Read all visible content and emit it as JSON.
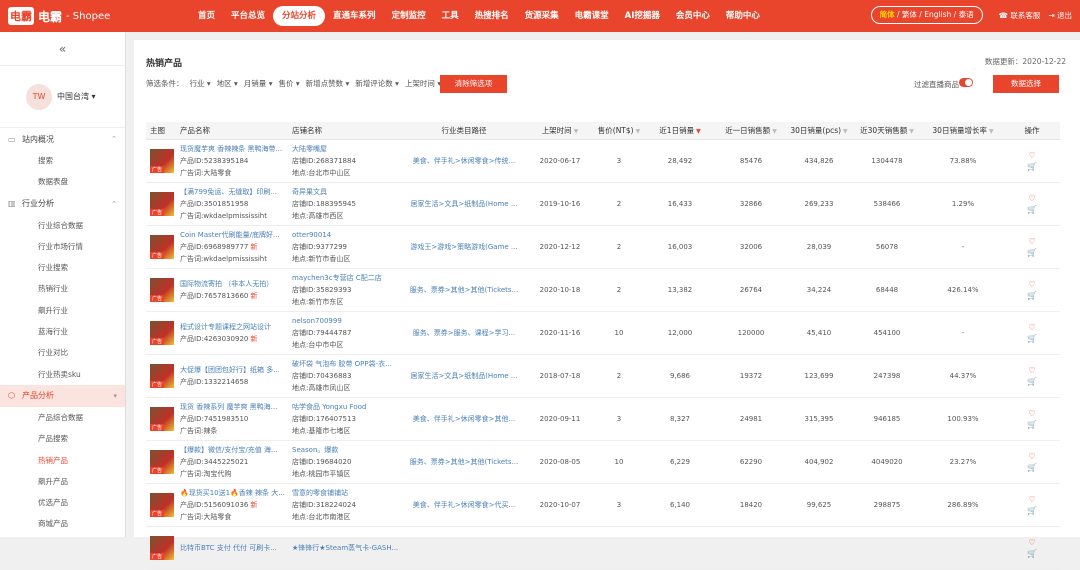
{
  "brand": {
    "mark": "电霸",
    "name": "电霸",
    "sub": "- Shopee"
  },
  "nav": [
    "首页",
    "平台总览",
    "分站分析",
    "直通车系列",
    "定制监控",
    "工具",
    "热搜排名",
    "货源采集",
    "电霸课堂",
    "AI挖掘器",
    "会员中心",
    "帮助中心"
  ],
  "nav_active": "分站分析",
  "lang": {
    "current": "简体",
    "others": " / 繁体 / English / 泰语"
  },
  "top_links": {
    "service": "联系客服",
    "logout": "退出"
  },
  "sidebar": {
    "collapse": "«",
    "avatar": "TW",
    "region": "中国台湾 ▾",
    "sections": [
      {
        "label": "站内概况",
        "items": [
          "搜索",
          "数据表盘"
        ]
      },
      {
        "label": "行业分析",
        "items": [
          "行业综合数据",
          "行业市场行情",
          "行业搜索",
          "热销行业",
          "飙升行业",
          "蓝海行业",
          "行业对比",
          "行业热卖sku"
        ]
      },
      {
        "label": "产品分析",
        "items": [
          "产品综合数据",
          "产品搜索",
          "热销产品",
          "飙升产品",
          "优选产品",
          "商城产品",
          "上新产品"
        ]
      }
    ],
    "current": "热销产品"
  },
  "page": {
    "title": "热销产品",
    "update": "数据更新：2020-12-22",
    "filter_label": "筛选条件：",
    "filters": [
      "行业 ▾",
      "地区 ▾",
      "月销量 ▾",
      "售价 ▾",
      "新增点赞数 ▾",
      "新增评论数 ▾",
      "上架时间 ▾"
    ],
    "clear_btn": "清除筛选项",
    "toggle_label": "过滤直播商品",
    "data_btn": "数据选择"
  },
  "columns": [
    "主图",
    "产品名称",
    "店铺名称",
    "行业类目路径",
    "上架时间",
    "售价(NT$)",
    "近1日销量",
    "近一日销售额",
    "30日销量(pcs)",
    "近30天销售额",
    "30日销量增长率",
    "操作"
  ],
  "rows": [
    {
      "name": "现货魔芋爽 香辣辣条 黑鸭海带...",
      "pid": "产品ID:5238395184",
      "kw": "广告词:大陆零食",
      "new": "",
      "shop": "大陆零嘴屋",
      "sid": "店铺ID:268371884",
      "addr": "地点:台北市中山区",
      "cat": "美食、伴手礼>休闲零食>传统...",
      "date": "2020-06-17",
      "price": "3",
      "d1": "28,492",
      "d1s": "85476",
      "m30": "434,826",
      "m30s": "1304478",
      "g": "73.88%"
    },
    {
      "name": "【满799免运、无缝取】印刷...",
      "pid": "产品ID:3501851958",
      "kw": "广告词:wkdaelpmississiht",
      "new": "",
      "shop": "奇异果文具",
      "sid": "店铺ID:188395945",
      "addr": "地点:高雄市西区",
      "cat": "居家生活>文具>纸制品(Home ...",
      "date": "2019-10-16",
      "price": "2",
      "d1": "16,433",
      "d1s": "32866",
      "m30": "269,233",
      "m30s": "538466",
      "g": "1.29%"
    },
    {
      "name": "Coin Master代刷能量/底牌好...",
      "pid": "产品ID:6968989777",
      "kw": "广告词:wkdaelpmississiht",
      "new": "新",
      "shop": "otter90014",
      "sid": "店铺ID:9377299",
      "addr": "地点:新竹市香山区",
      "cat": "游戏王>游戏>策略游戏(Game ...",
      "date": "2020-12-12",
      "price": "2",
      "d1": "16,003",
      "d1s": "32006",
      "m30": "28,039",
      "m30s": "56078",
      "g": "-"
    },
    {
      "name": "国际物流寄拍 （非本人无拍）",
      "pid": "产品ID:7657813660",
      "kw": "",
      "new": "新",
      "shop": "maychen3c专营店 C配二店",
      "sid": "店铺ID:35829393",
      "addr": "地点:新竹市东区",
      "cat": "服务、票券>其他>其他(Tickets...",
      "date": "2020-10-18",
      "price": "2",
      "d1": "13,382",
      "d1s": "26764",
      "m30": "34,224",
      "m30s": "68448",
      "g": "426.14%"
    },
    {
      "name": "程式设计专题课程之网站设计",
      "pid": "产品ID:4263030920",
      "kw": "",
      "new": "新",
      "shop": "nelson700999",
      "sid": "店铺ID:79444787",
      "addr": "地点:台中市中区",
      "cat": "服务、票券>服务、课程>学习...",
      "date": "2020-11-16",
      "price": "10",
      "d1": "12,000",
      "d1s": "120000",
      "m30": "45,410",
      "m30s": "454100",
      "g": "-"
    },
    {
      "name": "大促爆【团团包好行】纸箱 多...",
      "pid": "产品ID:1332214658",
      "kw": "",
      "new": "",
      "shop": "破坏袋 气泡布 胶带 OPP袋-衣...",
      "sid": "店铺ID:70436883",
      "addr": "地点:高雄市凤山区",
      "cat": "居家生活>文具>纸制品(Home ...",
      "date": "2018-07-18",
      "price": "2",
      "d1": "9,686",
      "d1s": "19372",
      "m30": "123,699",
      "m30s": "247398",
      "g": "44.37%"
    },
    {
      "name": "现货 香辣系列 魔芋爽 黑鸭海...",
      "pid": "产品ID:7451983510",
      "kw": "广告词:辣条",
      "new": "",
      "shop": "咕学食品 Yongxu Food",
      "sid": "店铺ID:176407513",
      "addr": "地点:基隆市七堵区",
      "cat": "美食、伴手礼>休闲零食>其他...",
      "date": "2020-09-11",
      "price": "3",
      "d1": "8,327",
      "d1s": "24981",
      "m30": "315,395",
      "m30s": "946185",
      "g": "100.93%"
    },
    {
      "name": "【爆款】微信/支付宝/充值 海...",
      "pid": "产品ID:3445225021",
      "kw": "广告词:淘宝代购",
      "new": "",
      "shop": "Season。爆款",
      "sid": "店铺ID:19684020",
      "addr": "地点:桃园市平镇区",
      "cat": "服务、票券>其他>其他(Tickets...",
      "date": "2020-08-05",
      "price": "10",
      "d1": "6,229",
      "d1s": "62290",
      "m30": "404,902",
      "m30s": "4049020",
      "g": "23.27%"
    },
    {
      "name": "🔥现货买10送1🔥香辣 辣条 大...",
      "pid": "产品ID:5156091036",
      "kw": "广告词:大陆零食",
      "new": "新",
      "shop": "雪意的零食铺铺站",
      "sid": "店铺ID:318224024",
      "addr": "地点:台北市南港区",
      "cat": "美食、伴手礼>休闲零食>代买...",
      "date": "2020-10-07",
      "price": "3",
      "d1": "6,140",
      "d1s": "18420",
      "m30": "99,625",
      "m30s": "298875",
      "g": "286.89%"
    },
    {
      "name": "比特币BTC 支付 代付 可刷卡...",
      "pid": "",
      "kw": "",
      "new": "",
      "shop": "★锋锋行★Steam蒸气卡-GASH...",
      "sid": "",
      "addr": "",
      "cat": "",
      "date": "",
      "price": "",
      "d1": "",
      "d1s": "",
      "m30": "",
      "m30s": "",
      "g": ""
    }
  ],
  "action": {
    "fav": "♡",
    "cart": "🛒"
  }
}
